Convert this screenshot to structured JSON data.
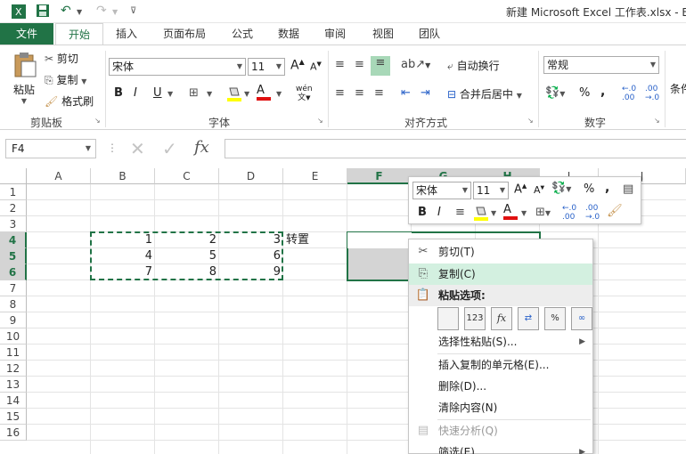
{
  "title": "新建 Microsoft Excel 工作表.xlsx - E",
  "tabs": [
    "文件",
    "开始",
    "插入",
    "页面布局",
    "公式",
    "数据",
    "审阅",
    "视图",
    "团队"
  ],
  "ribbon": {
    "paste": "粘贴",
    "cut": "剪切",
    "copy": "复制",
    "format_painter": "格式刷",
    "clipboard_label": "剪贴板",
    "font_name": "宋体",
    "font_size": "11",
    "font_label": "字体",
    "wrap_text": "自动换行",
    "merge_center": "合并后居中",
    "align_label": "对齐方式",
    "number_format": "常规",
    "number_label": "数字",
    "cond_format": "条件",
    "bold": "B",
    "italic": "I",
    "underline": "U",
    "grow_font": "A",
    "shrink_font": "A",
    "font_color_a": "A",
    "phonetic": "wén",
    "percent": "%",
    "comma": ","
  },
  "formula_bar": {
    "name_box": "F4",
    "fx": "fx",
    "cancel": "✕",
    "enter": "✓",
    "formula": ""
  },
  "columns": [
    "A",
    "B",
    "C",
    "D",
    "E",
    "F",
    "G",
    "H",
    "I",
    "J"
  ],
  "rows": [
    "1",
    "2",
    "3",
    "4",
    "5",
    "6",
    "7",
    "8",
    "9",
    "10",
    "11",
    "12",
    "13",
    "14",
    "15",
    "16"
  ],
  "cells": {
    "b4": "1",
    "c4": "2",
    "d4": "3",
    "b5": "4",
    "c5": "5",
    "d5": "6",
    "b6": "7",
    "c6": "8",
    "d6": "9",
    "e4": "转置"
  },
  "mini_toolbar": {
    "font": "宋体",
    "size": "11",
    "bold": "B",
    "italic": "I",
    "percent": "%",
    "comma": ","
  },
  "context_menu": {
    "cut": "剪切(T)",
    "copy": "复制(C)",
    "paste_options": "粘贴选项:",
    "paste_special": "选择性粘贴(S)...",
    "insert_copied": "插入复制的单元格(E)...",
    "delete": "删除(D)...",
    "clear": "清除内容(N)",
    "quick_analysis": "快速分析(Q)",
    "filter": "筛选(E)",
    "paste_icon_labels": [
      "",
      "123",
      "fx",
      "",
      "%",
      ""
    ]
  },
  "colors": {
    "accent": "#217346",
    "selection": "#d4d4d4",
    "menu_highlight": "#d3f0e0"
  }
}
